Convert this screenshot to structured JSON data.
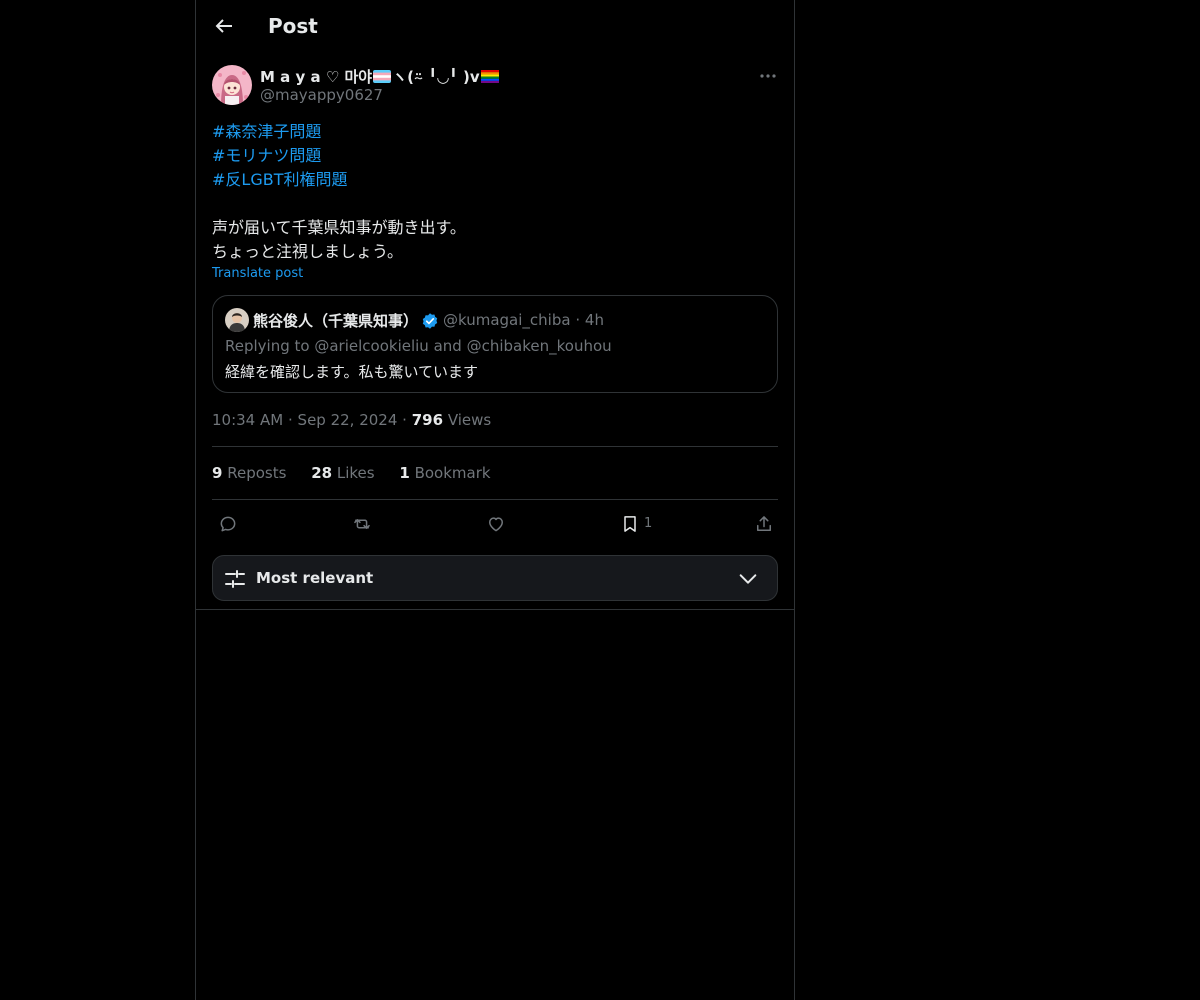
{
  "header": {
    "title": "Post",
    "back_icon": "arrow-left-icon"
  },
  "author": {
    "name_prefix": "M a y a ♡ 마야",
    "name_mid": "ヽ(⍨ ╹◡╹ )v",
    "handle": "@mayappy0627",
    "more_icon": "more-horizontal-icon"
  },
  "post": {
    "hashtags": [
      "#森奈津子問題",
      "#モリナツ問題",
      "#反LGBT利権問題"
    ],
    "lines": [
      "声が届いて千葉県知事が動き出す。",
      "ちょっと注視しましょう。"
    ],
    "translate": "Translate post"
  },
  "quote": {
    "name": "熊谷俊人（千葉県知事）",
    "handle": "@kumagai_chiba",
    "dot": "·",
    "time": "4h",
    "reply_prefix": "Replying to",
    "mention1": "@arielcookieliu",
    "reply_and": "and",
    "mention2": "@chibaken_kouhou",
    "text": "経緯を確認します。私も驚いています"
  },
  "meta": {
    "time": "10:34 AM",
    "dot1": "·",
    "date": "Sep 22, 2024",
    "dot2": "·",
    "views": "796",
    "views_label": "Views"
  },
  "stats": {
    "reposts": "9",
    "reposts_label": "Reposts",
    "likes": "28",
    "likes_label": "Likes",
    "bookmarks": "1",
    "bookmarks_label": "Bookmark"
  },
  "actions": {
    "bookmark_count": "1"
  },
  "sort": {
    "label": "Most relevant"
  },
  "colors": {
    "accent": "#1d9bf0",
    "background": "#000000",
    "text": "#e7e9ea",
    "muted": "#71767b",
    "border": "#2f3336"
  }
}
